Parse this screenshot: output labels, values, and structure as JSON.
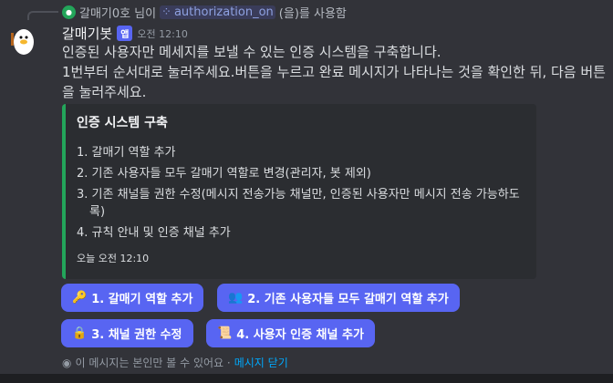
{
  "reply": {
    "user": "갈매기0호",
    "suffix": "님이",
    "command": "authorization_on",
    "used": "(을)를 사용함"
  },
  "message": {
    "author": "갈매기봇",
    "badge": "앱",
    "time": "오전 12:10",
    "lines": [
      "인증된 사용자만 메세지를 보낼 수 있는 인증 시스템을 구축합니다.",
      "1번부터 순서대로 눌러주세요.버튼을 누르고 완료 메시지가 나타나는 것을 확인한 뒤, 다음 버튼을 눌러주세요."
    ]
  },
  "embed": {
    "title": "인증 시스템 구축",
    "items": [
      "1. 갈매기 역할 추가",
      "2. 기존 사용자들 모두 갈매기 역할로 변경(관리자, 봇 제외)",
      "3. 기존 채널들 권한 수정(메시지 전송가능 채널만, 인증된 사용자만 메시지 전송 가능하도록)",
      "4. 규칙 안내 및 인증 채널 추가"
    ],
    "footer": "오늘 오전 12:10",
    "color": "#23a55a"
  },
  "buttons": [
    {
      "icon": "🔑",
      "label": "1. 갈매기 역할 추가"
    },
    {
      "icon": "👥",
      "label": "2. 기존 사용자들 모두 갈매기 역할 추가"
    },
    {
      "icon": "🔒",
      "label": "3. 채널 권한 수정"
    },
    {
      "icon": "📜",
      "label": "4. 사용자 인증 채널 추가"
    }
  ],
  "note": {
    "text": "이 메시지는 본인만 볼 수 있어요 ·",
    "dismiss": "메시지 닫기"
  }
}
